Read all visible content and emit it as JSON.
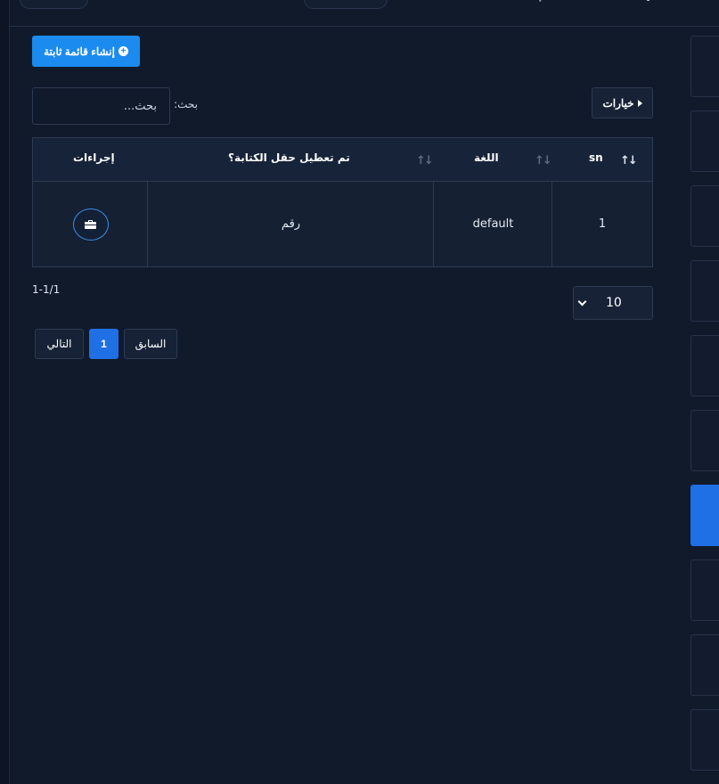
{
  "toolbar": {
    "create_label": "إنشاء قائمة ثابتة",
    "options_label": "خيارات"
  },
  "search": {
    "label": "بحث:",
    "placeholder": "بحث..."
  },
  "table": {
    "columns": [
      {
        "key": "sn",
        "label": "sn"
      },
      {
        "key": "language",
        "label": "اللغة"
      },
      {
        "key": "disable_typing",
        "label": "تم تعطيل حقل الكتابة؟"
      },
      {
        "key": "actions",
        "label": "إجراءات"
      }
    ],
    "rows": [
      {
        "sn": "1",
        "language": "default",
        "disable_typing": "رقم"
      }
    ]
  },
  "pagination": {
    "range": "1-1/1",
    "page_size": "10",
    "prev_label": "السابق",
    "current_page": "1",
    "next_label": "التالي"
  },
  "icons": {
    "create": "plus-circle-icon",
    "options": "caret-left-icon",
    "sort": "sort-arrows-icon",
    "action": "briefcase-icon",
    "page_size": "chevron-down-icon"
  },
  "colors": {
    "background": "#111a2b",
    "primary": "#1b8bf0",
    "active_page": "#1f6fe5",
    "border": "#2c3a52"
  }
}
